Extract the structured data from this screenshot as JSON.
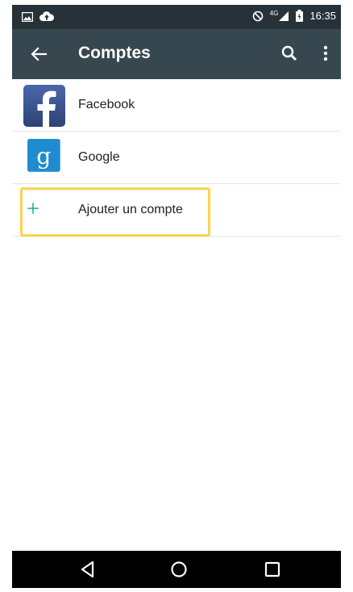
{
  "status_bar": {
    "time": "16:35",
    "network": "4G",
    "icons_left": [
      "image-notification-icon",
      "cloud-upload-icon"
    ],
    "icons_right": [
      "do-not-disturb-icon",
      "signal-icon",
      "battery-charging-icon"
    ]
  },
  "toolbar": {
    "title": "Comptes",
    "background": "#37474f"
  },
  "accounts": [
    {
      "label": "Facebook",
      "icon": "facebook-icon",
      "color": "#3b5998"
    },
    {
      "label": "Google",
      "icon": "google-icon",
      "color": "#1f8bd1"
    }
  ],
  "add_account": {
    "label": "Ajouter un compte",
    "icon": "plus-icon",
    "color": "#26a69a"
  },
  "highlight_color": "#fbd34d"
}
